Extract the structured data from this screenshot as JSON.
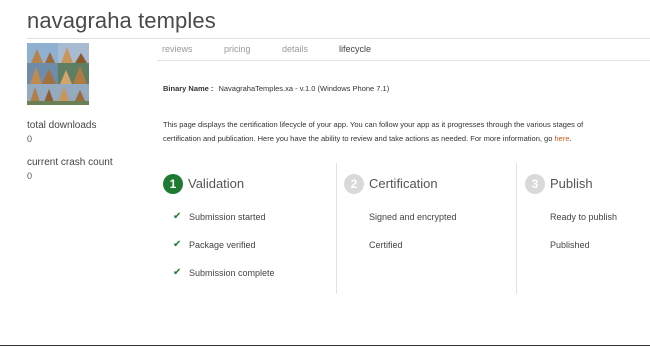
{
  "app": {
    "title": "navagraha temples"
  },
  "sidebar": {
    "stats": [
      {
        "label": "total downloads",
        "value": "0"
      },
      {
        "label": "current crash count",
        "value": "0"
      }
    ]
  },
  "tabs": [
    {
      "label": "reviews",
      "active": false
    },
    {
      "label": "pricing",
      "active": false
    },
    {
      "label": "details",
      "active": false
    },
    {
      "label": "lifecycle",
      "active": true
    }
  ],
  "binary": {
    "label": "Binary Name :",
    "value": "NavagrahaTemples.xa - v.1.0 (Windows Phone 7.1)"
  },
  "description": {
    "line1": "This page displays the certification lifecycle of your app. You can follow your app as it progresses through the various stages of",
    "line2": "certification and publication. Here you have the ability to review and take actions as needed. For more information, go",
    "link": "here",
    "end": "."
  },
  "stages": [
    {
      "number": "1",
      "title": "Validation",
      "status": "complete",
      "items": [
        "Submission started",
        "Package verified",
        "Submission complete"
      ]
    },
    {
      "number": "2",
      "title": "Certification",
      "status": "pending",
      "items": [
        "Signed and encrypted",
        "Certified"
      ]
    },
    {
      "number": "3",
      "title": "Publish",
      "status": "pending",
      "items": [
        "Ready to publish",
        "Published"
      ]
    }
  ],
  "colors": {
    "accent_green": "#1f7a31",
    "link_orange": "#d05a1a",
    "pending_gray": "#d9d9d9"
  },
  "icons": [
    "check-icon",
    "app-thumbnail"
  ]
}
